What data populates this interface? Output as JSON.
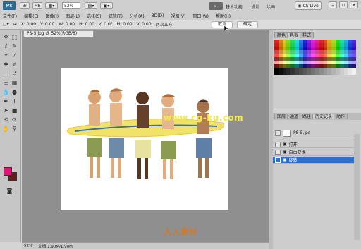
{
  "app": {
    "logo": "Ps",
    "zoom": "52%",
    "workspace_active": "基本功能",
    "workspace_design": "设计",
    "workspace_painting": "绘画",
    "cslive": "CS Live"
  },
  "menus": [
    "文件(F)",
    "编辑(E)",
    "图像(I)",
    "图层(L)",
    "选择(S)",
    "滤镜(T)",
    "分析(A)",
    "3D(D)",
    "视图(V)",
    "窗口(W)",
    "帮助(H)"
  ],
  "options": {
    "x": "X: 0.00",
    "y": "Y: 0.00",
    "w": "W: 0.00",
    "h": "H: 0.00",
    "angle": "∠ 0.0°",
    "h_skew": "H: 0.00",
    "v_skew": "V: 0.00",
    "interp": "两次立方",
    "cancel_label": "取消",
    "commit_label": "确定"
  },
  "document": {
    "tab_title": "PS-5.jpg @ 52%(RGB/8)",
    "status_zoom": "52%",
    "status_doc": "文档:1.90M/1.90M"
  },
  "colors": {
    "foreground": "#e0157a",
    "background": "#6b1a1a",
    "selected_layer": "#2f6fd0"
  },
  "swatches_panel": {
    "tab_color": "颜色",
    "tab_swatches": "色板",
    "tab_styles": "样式"
  },
  "layers_panel": {
    "tabs": [
      "图层",
      "通道",
      "路径",
      "历史记录",
      "动作"
    ],
    "history_snapshot": "PS-5.jpg",
    "items": [
      {
        "label": "打开"
      },
      {
        "label": "自由变换"
      },
      {
        "label": "旋转"
      }
    ]
  },
  "watermarks": {
    "top": "www.cg-ku.com",
    "bottom": "人人素材"
  }
}
